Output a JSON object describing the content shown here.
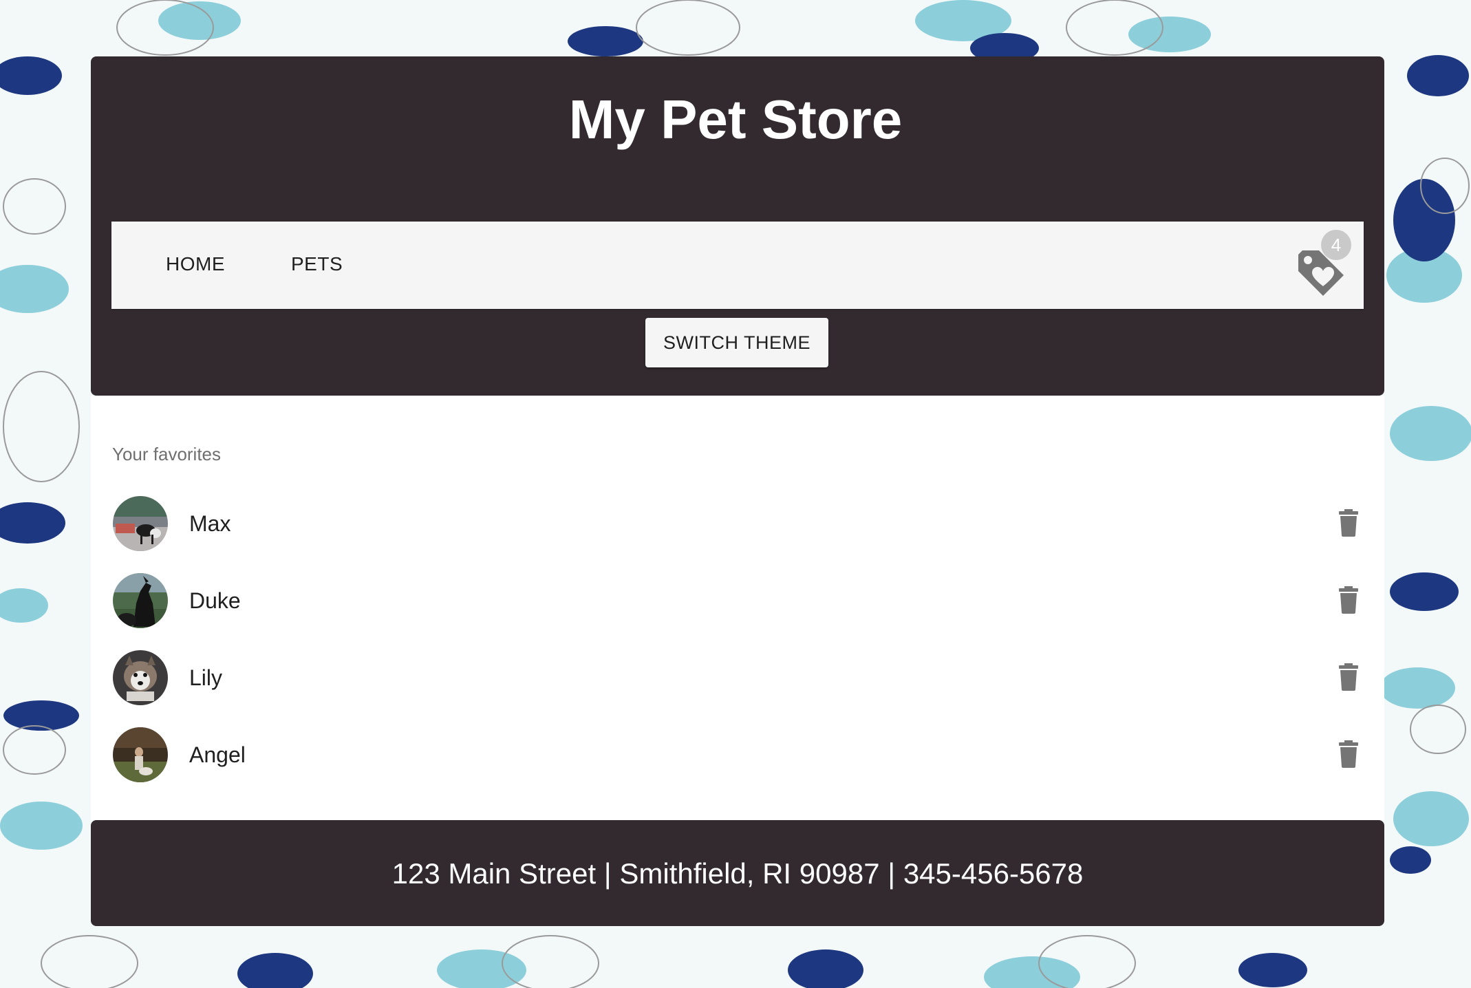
{
  "header": {
    "title": "My Pet Store"
  },
  "nav": {
    "items": [
      {
        "label": "HOME"
      },
      {
        "label": "PETS"
      }
    ],
    "favorites_count": "4"
  },
  "theme_button": {
    "label": "SWITCH THEME"
  },
  "favorites": {
    "heading": "Your favorites",
    "items": [
      {
        "name": "Max"
      },
      {
        "name": "Duke"
      },
      {
        "name": "Lily"
      },
      {
        "name": "Angel"
      }
    ]
  },
  "footer": {
    "text": "123 Main Street | Smithfield, RI 90987 | 345-456-5678"
  },
  "colors": {
    "header_bg": "#322a2f",
    "nav_bg": "#f5f5f5",
    "icon_gray": "#757575",
    "badge_gray": "#c9c9c9"
  },
  "icons": [
    "favorite-tag-icon",
    "trash-icon"
  ]
}
